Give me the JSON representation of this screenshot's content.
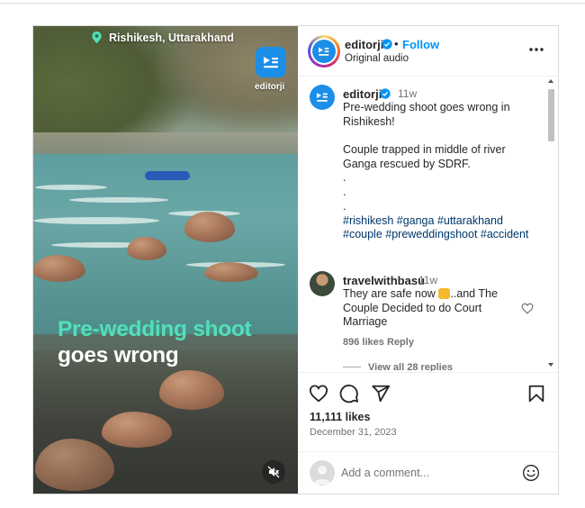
{
  "media": {
    "location": "Rishikesh, Uttarakhand",
    "brand_label": "editorji",
    "headline_line1": "Pre-wedding shoot",
    "headline_line2": "goes wrong",
    "headline_accent_color": "#52e0b8",
    "icons": [
      "location-pin-icon",
      "editorji-logo-icon",
      "mute-icon"
    ]
  },
  "header": {
    "username": "editorji",
    "follow_label": "Follow",
    "subtitle": "Original audio",
    "separator": "•"
  },
  "caption": {
    "username": "editorji",
    "time": "11w",
    "lines": [
      "Pre-wedding shoot goes wrong in",
      "Rishikesh!",
      "",
      "Couple trapped in middle of river",
      "Ganga rescued by SDRF.",
      ".",
      ".",
      ".",
      "#rishikesh #ganga #uttarakhand",
      "#couple #preweddingshoot #accident"
    ]
  },
  "comment": {
    "username": "travelwithbasu",
    "time": "11w",
    "line1_before": "They are safe now ",
    "line1_after": "..and The",
    "line2": "Couple Decided to do Court",
    "line3": "Marriage",
    "likes": "896 likes",
    "reply_label": "Reply",
    "view_replies": "View all 28 replies"
  },
  "actions": {
    "likes": "11,111 likes",
    "date": "December 31, 2023",
    "icons": [
      "heart-icon",
      "comment-icon",
      "share-icon",
      "bookmark-icon"
    ]
  },
  "composer": {
    "placeholder": "Add a comment..."
  },
  "colors": {
    "brand_blue": "#1c8ee8",
    "follow_blue": "#0095f6",
    "hashtag_blue": "#00376b"
  }
}
